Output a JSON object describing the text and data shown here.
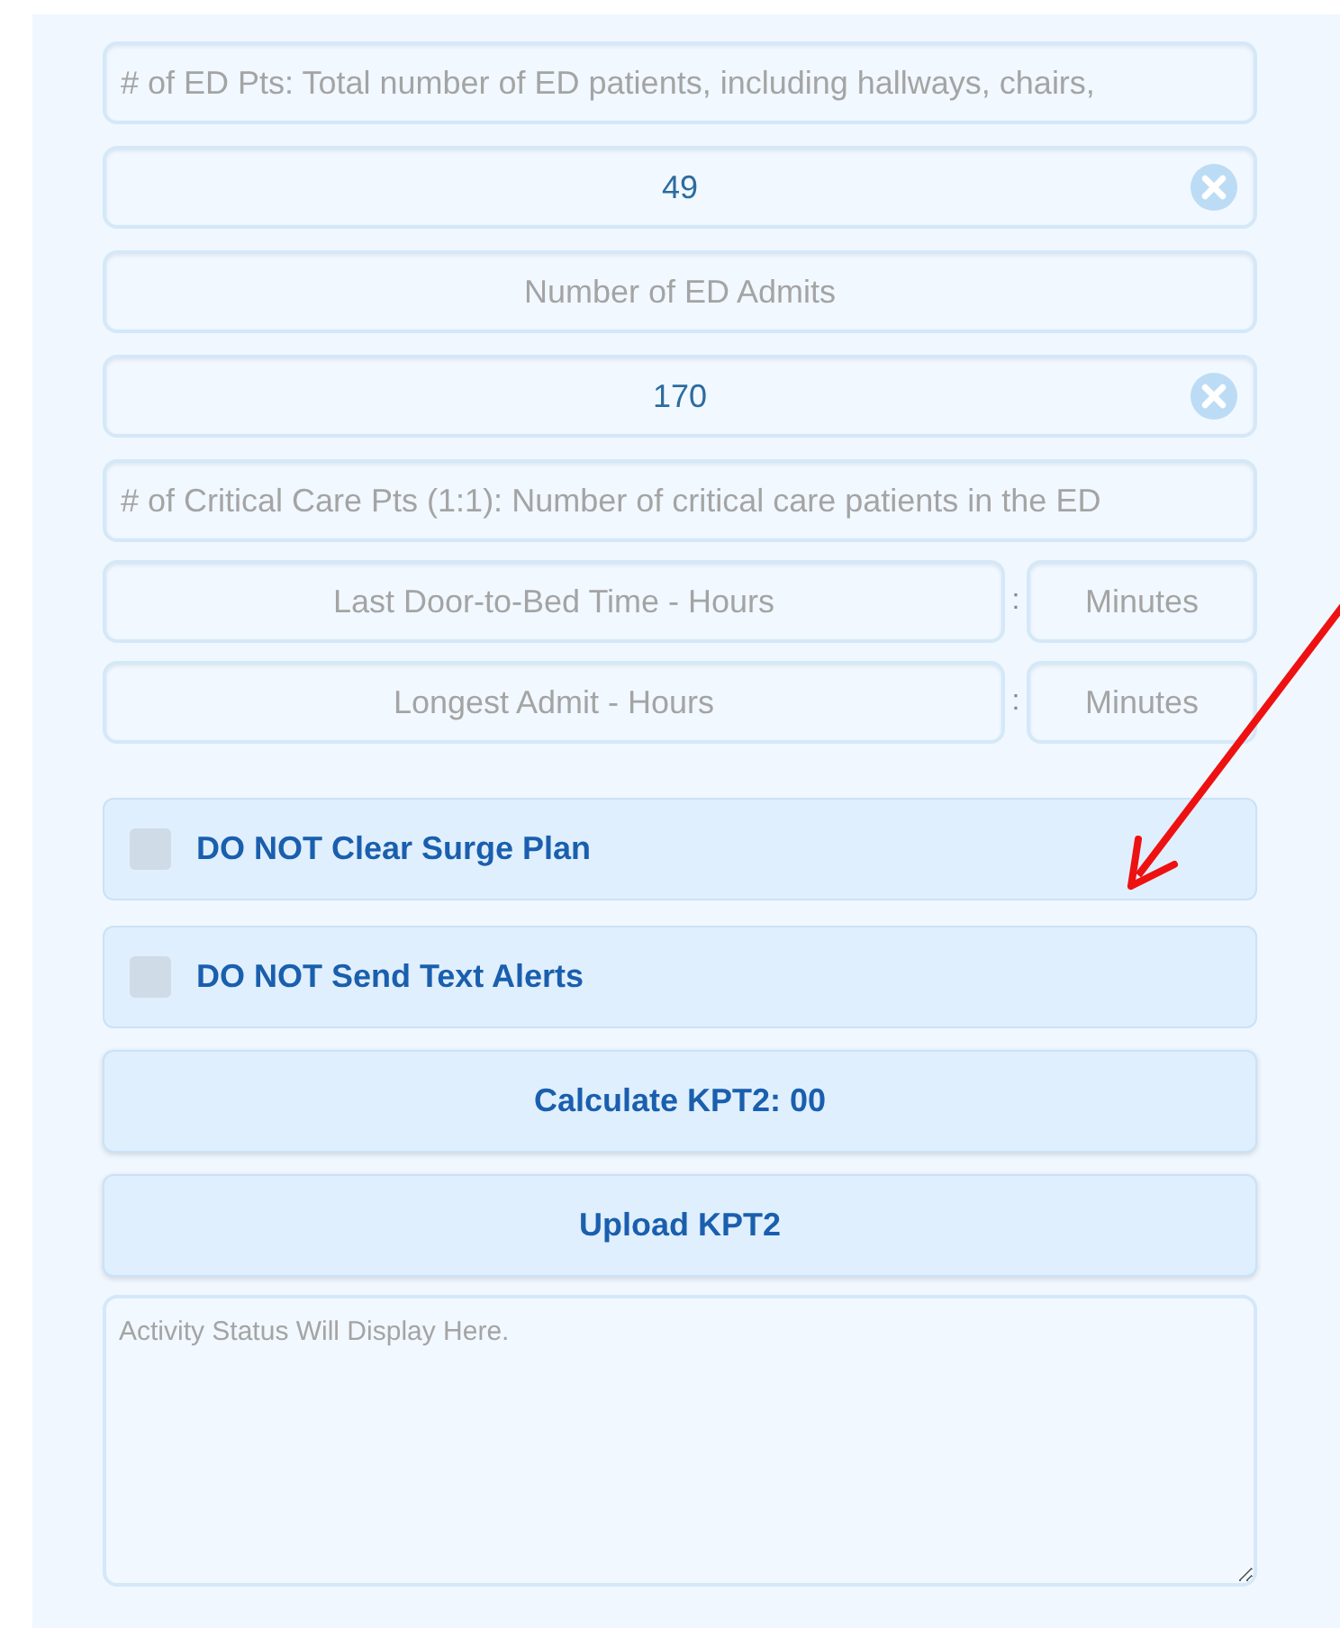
{
  "fields": [
    {
      "kind": "hint",
      "placeholder": "# of ED Pts: Total number of ED patients, including hallways, chairs,"
    },
    {
      "kind": "field",
      "value": "49"
    },
    {
      "kind": "field",
      "placeholder": "Number of ED Admits"
    },
    {
      "kind": "field",
      "value": "170"
    },
    {
      "kind": "hint",
      "placeholder": "# of Critical Care Pts (1:1): Number of critical care patients in the ED"
    },
    {
      "kind": "time",
      "hours_placeholder": "Last Door-to-Bed Time - Hours",
      "separator": ":",
      "minutes_placeholder": "Minutes"
    },
    {
      "kind": "time",
      "hours_placeholder": "Longest Admit - Hours",
      "separator": ":",
      "minutes_placeholder": "Minutes"
    }
  ],
  "options": [
    {
      "label": "DO NOT Clear Surge Plan",
      "checked": false
    },
    {
      "label": "DO NOT Send Text Alerts",
      "checked": false
    }
  ],
  "buttons": [
    "Calculate KPT2: 00",
    "Upload KPT2"
  ],
  "status_box": {
    "placeholder": "Activity Status Will Display Here."
  }
}
